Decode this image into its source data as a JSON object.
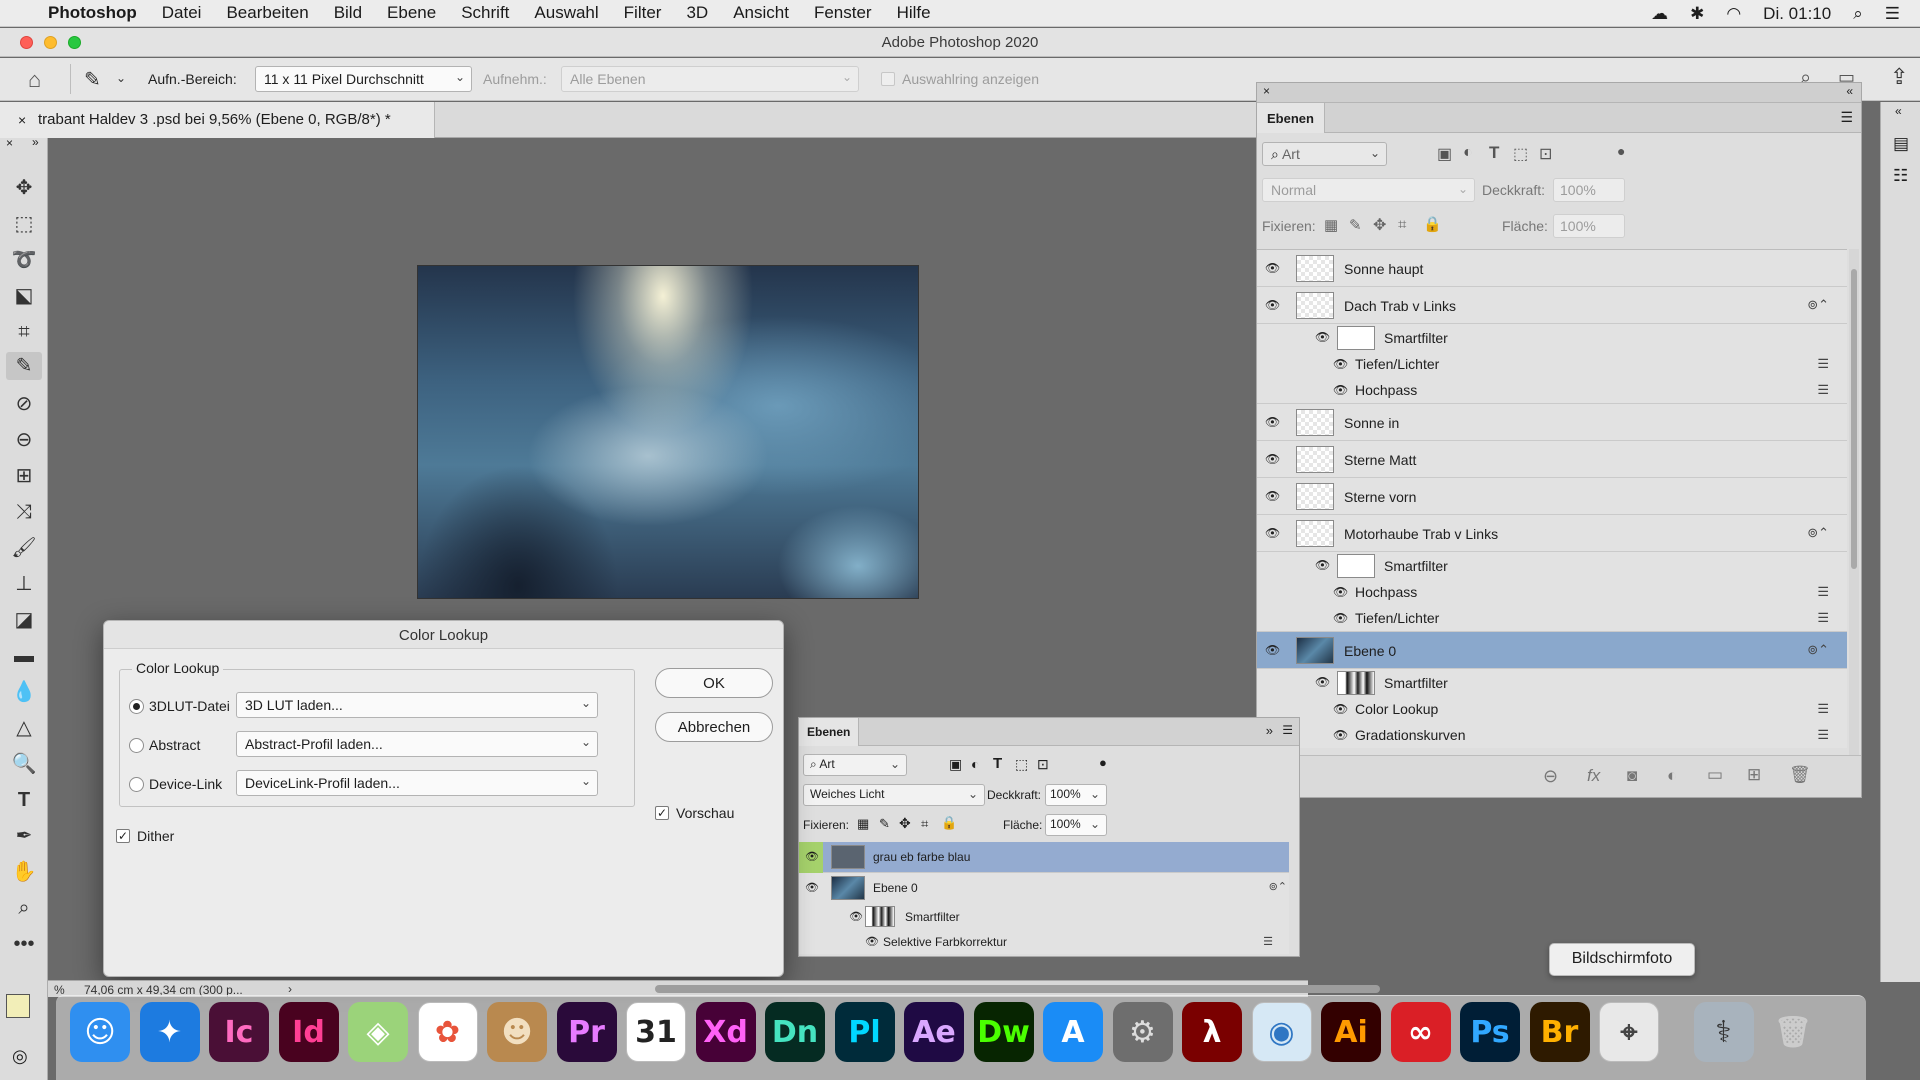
{
  "menubar": {
    "apple_icon": "apple-icon",
    "items": [
      "Photoshop",
      "Datei",
      "Bearbeiten",
      "Bild",
      "Ebene",
      "Schrift",
      "Auswahl",
      "Filter",
      "3D",
      "Ansicht",
      "Fenster",
      "Hilfe"
    ],
    "clock": "Di. 01:10"
  },
  "window": {
    "title": "Adobe Photoshop 2020"
  },
  "options": {
    "sample_label": "Aufn.-Bereich:",
    "sample_value": "11 x 11 Pixel Durchschnitt",
    "sample_layers_label": "Aufnehm.:",
    "sample_layers_value": "Alle Ebenen",
    "ring_label": "Auswahlring anzeigen"
  },
  "document": {
    "tab_title": "trabant Haldev 3 .psd bei 9,56% (Ebene 0, RGB/8*) *"
  },
  "status": {
    "zoom": "%",
    "size": "74,06 cm x 49,34 cm (300 p..."
  },
  "color_lookup": {
    "title": "Color Lookup",
    "group_label": "Color Lookup",
    "rows": [
      {
        "label": "3DLUT-Datei",
        "value": "3D LUT laden...",
        "selected": true
      },
      {
        "label": "Abstract",
        "value": "Abstract-Profil laden...",
        "selected": false
      },
      {
        "label": "Device-Link",
        "value": "DeviceLink-Profil laden...",
        "selected": false
      }
    ],
    "dither_label": "Dither",
    "ok_label": "OK",
    "cancel_label": "Abbrechen",
    "preview_label": "Vorschau"
  },
  "layers_main": {
    "tab": "Ebenen",
    "filter_value": "Art",
    "blend_mode": "Normal",
    "opacity_label": "Deckkraft:",
    "opacity_value": "100%",
    "lock_label": "Fixieren:",
    "fill_label": "Fläche:",
    "fill_value": "100%",
    "layers": [
      {
        "name": "Sonne haupt",
        "kind": "layer"
      },
      {
        "name": "Dach Trab v Links",
        "kind": "smart"
      },
      {
        "name": "Smartfilter",
        "kind": "filtermask"
      },
      {
        "name": "Tiefen/Lichter",
        "kind": "filter"
      },
      {
        "name": "Hochpass",
        "kind": "filter"
      },
      {
        "name": "Sonne in",
        "kind": "layer"
      },
      {
        "name": "Sterne Matt",
        "kind": "layer"
      },
      {
        "name": "Sterne vorn",
        "kind": "layer"
      },
      {
        "name": "Motorhaube Trab v Links",
        "kind": "smart"
      },
      {
        "name": "Smartfilter",
        "kind": "filtermask"
      },
      {
        "name": "Hochpass",
        "kind": "filter"
      },
      {
        "name": "Tiefen/Lichter",
        "kind": "filter"
      },
      {
        "name": "Ebene 0",
        "kind": "smart-selected"
      },
      {
        "name": "Smartfilter",
        "kind": "filtermask-bw"
      },
      {
        "name": "Color Lookup",
        "kind": "filter"
      },
      {
        "name": "Gradationskurven",
        "kind": "filter"
      }
    ]
  },
  "layers_small": {
    "tab": "Ebenen",
    "filter_value": "Art",
    "blend_mode": "Weiches Licht",
    "opacity_label": "Deckkraft:",
    "opacity_value": "100%",
    "lock_label": "Fixieren:",
    "fill_label": "Fläche:",
    "fill_value": "100%",
    "layers": [
      {
        "name": "grau eb farbe blau"
      },
      {
        "name": "Ebene 0"
      },
      {
        "name": "Smartfilter"
      },
      {
        "name": "Selektive Farbkorrektur"
      }
    ]
  },
  "tooltip": "Bildschirmfoto",
  "dock": [
    {
      "name": "finder",
      "label": "☺",
      "bg": "#2f8ff0",
      "fg": "#ffffff"
    },
    {
      "name": "safari",
      "label": "✦",
      "bg": "#1d7be0",
      "fg": "#ffffff"
    },
    {
      "name": "incopy",
      "label": "Ic",
      "bg": "#4a0f36",
      "fg": "#ff6bc1"
    },
    {
      "name": "indesign",
      "label": "Id",
      "bg": "#49021f",
      "fg": "#ff3f94"
    },
    {
      "name": "maps",
      "label": "◈",
      "bg": "#9bd37a",
      "fg": "#ffffff"
    },
    {
      "name": "photos",
      "label": "✿",
      "bg": "#ffffff",
      "fg": "#e8543b"
    },
    {
      "name": "contacts",
      "label": "☻",
      "bg": "#b9894f",
      "fg": "#f2dfc0"
    },
    {
      "name": "premiere",
      "label": "Pr",
      "bg": "#2a0a3a",
      "fg": "#e77bff"
    },
    {
      "name": "calendar",
      "label": "31",
      "bg": "#ffffff",
      "fg": "#222222"
    },
    {
      "name": "xd",
      "label": "Xd",
      "bg": "#470137",
      "fg": "#ff61f6"
    },
    {
      "name": "dimension",
      "label": "Dn",
      "bg": "#052b22",
      "fg": "#45e3c0"
    },
    {
      "name": "prelude",
      "label": "Pl",
      "bg": "#002b3a",
      "fg": "#00d8ff"
    },
    {
      "name": "after-effects",
      "label": "Ae",
      "bg": "#1f0a44",
      "fg": "#d9a7ff"
    },
    {
      "name": "dreamweaver",
      "label": "Dw",
      "bg": "#072501",
      "fg": "#4aff00"
    },
    {
      "name": "app-store",
      "label": "A",
      "bg": "#1a8cf6",
      "fg": "#ffffff"
    },
    {
      "name": "system-preferences",
      "label": "⚙",
      "bg": "#6e6e6e",
      "fg": "#dddddd"
    },
    {
      "name": "acrobat",
      "label": "λ",
      "bg": "#7a0000",
      "fg": "#ffffff"
    },
    {
      "name": "disk-utility",
      "label": "◉",
      "bg": "#d6e8f5",
      "fg": "#2f76c3"
    },
    {
      "name": "illustrator",
      "label": "Ai",
      "bg": "#330000",
      "fg": "#ff9a00"
    },
    {
      "name": "creative-cloud",
      "label": "∞",
      "bg": "#da1f26",
      "fg": "#ffffff"
    },
    {
      "name": "photoshop",
      "label": "Ps",
      "bg": "#001e36",
      "fg": "#31a8ff"
    },
    {
      "name": "bridge",
      "label": "Br",
      "bg": "#2e1a00",
      "fg": "#ffb000"
    },
    {
      "name": "screenshot",
      "label": "⌖",
      "bg": "#e8e8e8",
      "fg": "#444444"
    },
    {
      "name": "utilities",
      "label": "⚕",
      "bg": "#a8b3bd",
      "fg": "#333333"
    },
    {
      "name": "trash",
      "label": "🗑",
      "bg": "transparent",
      "fg": "#cccccc"
    }
  ]
}
